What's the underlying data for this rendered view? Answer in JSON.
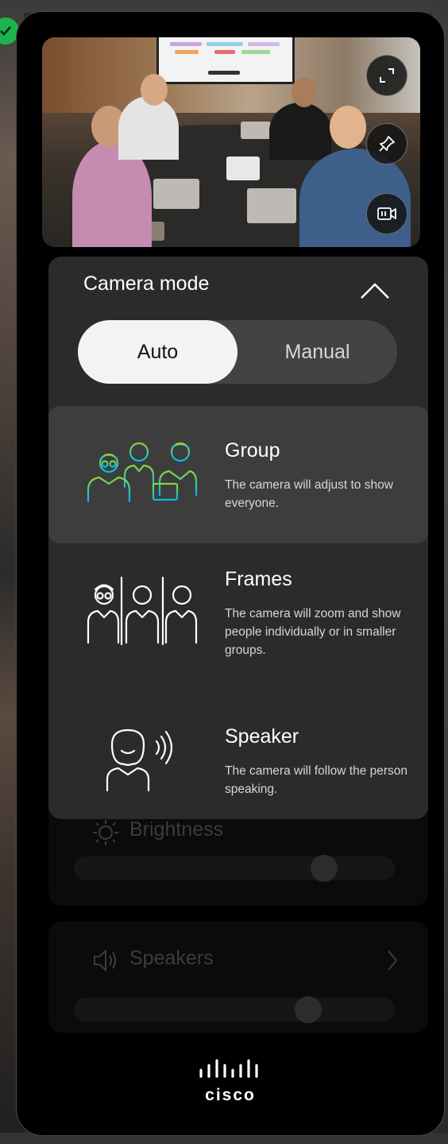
{
  "camera_mode": {
    "title": "Camera mode",
    "segments": [
      {
        "label": "Auto",
        "active": true
      },
      {
        "label": "Manual",
        "active": false
      }
    ],
    "modes": [
      {
        "name": "Group",
        "description": "The camera will adjust to show everyone.",
        "icon": "group-icon",
        "selected": true
      },
      {
        "name": "Frames",
        "description": "The camera will zoom and show people individually or in smaller groups.",
        "icon": "frames-icon",
        "selected": false
      },
      {
        "name": "Speaker",
        "description": "The camera will follow the person speaking.",
        "icon": "speaker-tracking-icon",
        "selected": false
      }
    ]
  },
  "preview": {
    "buttons": [
      "expand-icon",
      "pin-icon",
      "camera-switch-icon"
    ]
  },
  "background_controls": {
    "brightness_label": "Brightness",
    "brightness_value": 0.78,
    "speakers_label": "Speakers",
    "speakers_value": 0.73
  },
  "brand": {
    "logo_text": "cisco"
  },
  "colors": {
    "panel": "#000000",
    "card": "#2b2b2b",
    "selected_item": "#3d3d3d",
    "segment_active": "#f3f3f3",
    "group_icon_gradient": [
      "#8bd43b",
      "#00bceb"
    ]
  }
}
